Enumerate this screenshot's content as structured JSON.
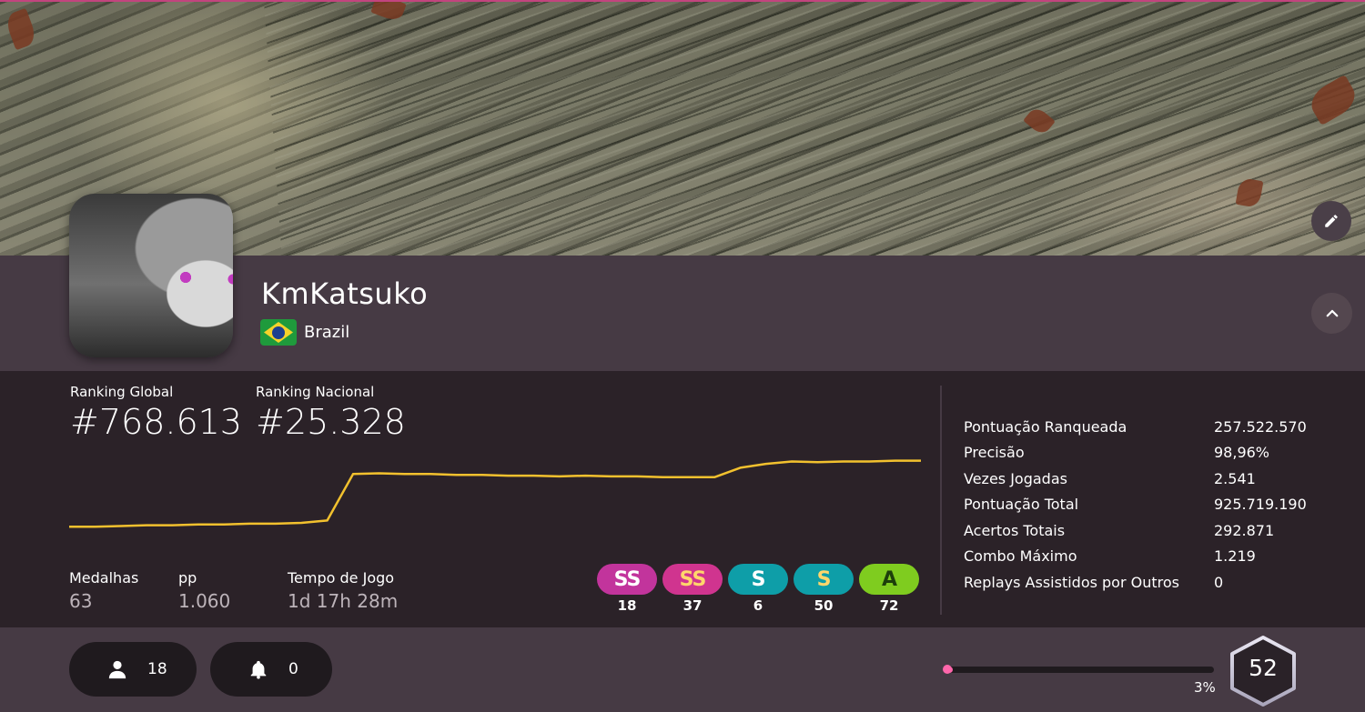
{
  "profile": {
    "username": "KmKatsuko",
    "country": "Brazil"
  },
  "ranks": {
    "global_label": "Ranking Global",
    "global_value": "#768.613",
    "national_label": "Ranking Nacional",
    "national_value": "#25.328"
  },
  "mini_stats": [
    {
      "label": "Medalhas",
      "value": "63"
    },
    {
      "label": "pp",
      "value": "1.060"
    },
    {
      "label": "Tempo de Jogo",
      "value": "1d 17h 28m"
    }
  ],
  "grades": [
    {
      "label": "SS",
      "count": "18",
      "color": "#c2349c",
      "text_color": "#ffffff"
    },
    {
      "label": "SS",
      "count": "37",
      "color": "#d0348f",
      "text_color": "#ffd66b"
    },
    {
      "label": "S",
      "count": "6",
      "color": "#0e9ea8",
      "text_color": "#ffffff"
    },
    {
      "label": "S",
      "count": "50",
      "color": "#0e9ea8",
      "text_color": "#ffd66b"
    },
    {
      "label": "A",
      "count": "72",
      "color": "#7fcc1f",
      "text_color": "#1d3f0b"
    }
  ],
  "right_stats": [
    {
      "key": "Pontuação Ranqueada",
      "value": "257.522.570"
    },
    {
      "key": "Precisão",
      "value": "98,96%"
    },
    {
      "key": "Vezes Jogadas",
      "value": "2.541"
    },
    {
      "key": "Pontuação Total",
      "value": "925.719.190"
    },
    {
      "key": "Acertos Totais",
      "value": "292.871"
    },
    {
      "key": "Combo Máximo",
      "value": "1.219"
    },
    {
      "key": "Replays Assistidos por Outros",
      "value": "0"
    }
  ],
  "social": {
    "friends_count": "18",
    "followers_count": "0"
  },
  "level": {
    "value": "52",
    "progress_label": "3%",
    "progress": 0.03
  },
  "colors": {
    "accent": "#ff66ab",
    "chart_line": "#f2c12e",
    "panel": "#2b2228",
    "bar": "#463a44"
  },
  "chart_data": {
    "type": "line",
    "series": [
      {
        "values": [
          25,
          25,
          26,
          27,
          27,
          28,
          28,
          29,
          29,
          30,
          33,
          92,
          93,
          92,
          92,
          91,
          91,
          90,
          90,
          89,
          90,
          89,
          89,
          88,
          88,
          88,
          100,
          105,
          108,
          107,
          108,
          108,
          109,
          109
        ]
      }
    ]
  }
}
